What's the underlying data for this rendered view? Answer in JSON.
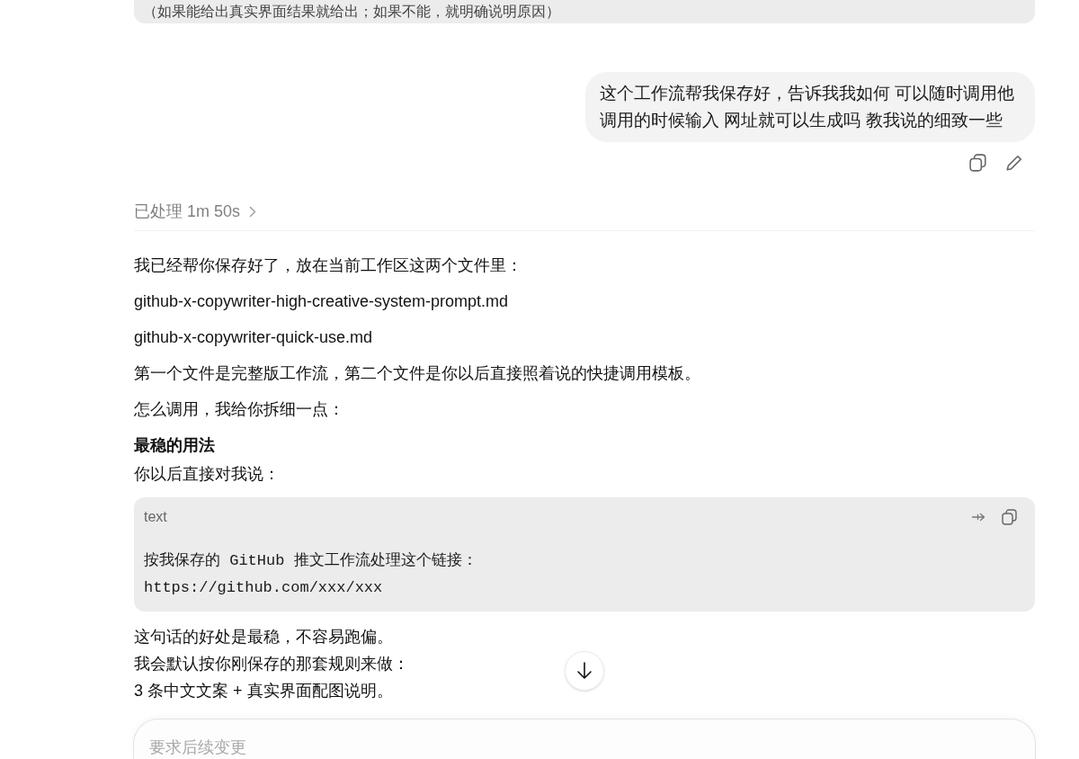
{
  "previous_message": {
    "text": "（如果能给出真实界面结果就给出；如果不能，就明确说明原因）"
  },
  "user_message": {
    "text": "这个工作流帮我保存好，告诉我我如何 可以随时调用他调用的时候输入 网址就可以生成吗 教我说的细致一些"
  },
  "processing": {
    "label": "已处理 1m 50s",
    "expanded": false
  },
  "response": [
    {
      "kind": "paragraph",
      "lines": [
        "我已经帮你保存好了，放在当前工作区这两个文件里："
      ]
    },
    {
      "kind": "paragraph",
      "lines": [
        "github-x-copywriter-high-creative-system-prompt.md"
      ]
    },
    {
      "kind": "paragraph",
      "lines": [
        "github-x-copywriter-quick-use.md"
      ]
    },
    {
      "kind": "paragraph",
      "lines": [
        "第一个文件是完整版工作流，第二个文件是你以后直接照着说的快捷调用模板。"
      ]
    },
    {
      "kind": "paragraph",
      "lines": [
        "怎么调用，我给你拆细一点："
      ]
    },
    {
      "kind": "heading",
      "text": "最稳的用法"
    },
    {
      "kind": "paragraph",
      "lines": [
        "你以后直接对我说："
      ]
    },
    {
      "kind": "code",
      "language": "text",
      "lines": [
        "按我保存的 GitHub 推文工作流处理这个链接：",
        "https://github.com/xxx/xxx"
      ]
    },
    {
      "kind": "paragraph",
      "lines": [
        "这句话的好处是最稳，不容易跑偏。",
        "我会默认按你刚保存的那套规则来做：",
        "3 条中文文案 + 真实界面配图说明。"
      ]
    }
  ],
  "composer": {
    "placeholder": "要求后续变更"
  }
}
